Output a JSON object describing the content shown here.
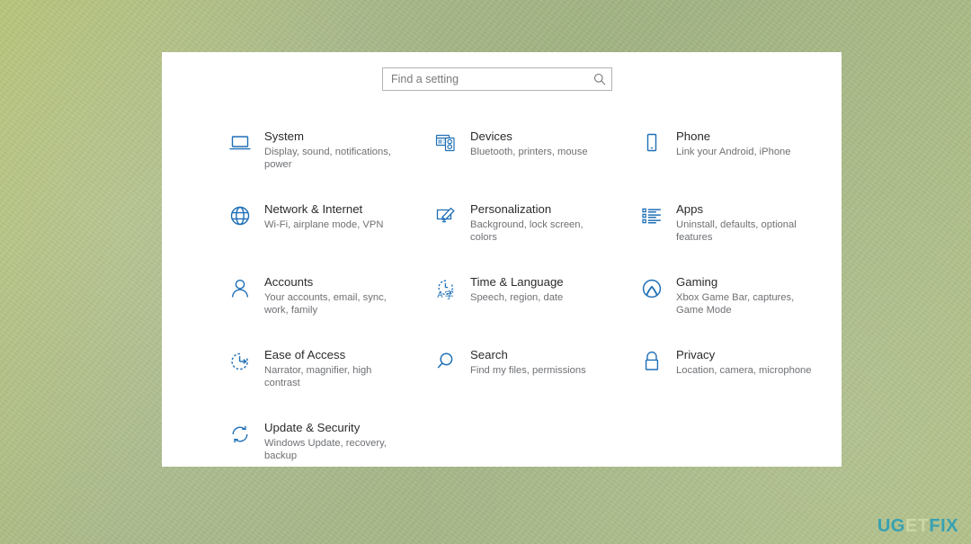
{
  "background": {
    "color": "#a9b98b",
    "accent_color": "#1e6fb6"
  },
  "window": {
    "search": {
      "placeholder": "Find a setting",
      "value": "Find a setting",
      "icon": "search-icon"
    },
    "tiles": [
      {
        "id": "system",
        "icon": "laptop-icon",
        "title": "System",
        "desc": "Display, sound, notifications, power"
      },
      {
        "id": "devices",
        "icon": "keyboard-devices-icon",
        "title": "Devices",
        "desc": "Bluetooth, printers, mouse"
      },
      {
        "id": "phone",
        "icon": "phone-icon",
        "title": "Phone",
        "desc": "Link your Android, iPhone"
      },
      {
        "id": "network-internet",
        "icon": "globe-icon",
        "title": "Network & Internet",
        "desc": "Wi-Fi, airplane mode, VPN"
      },
      {
        "id": "personalization",
        "icon": "paintbrush-monitor-icon",
        "title": "Personalization",
        "desc": "Background, lock screen, colors"
      },
      {
        "id": "apps",
        "icon": "list-icon",
        "title": "Apps",
        "desc": "Uninstall, defaults, optional features"
      },
      {
        "id": "accounts",
        "icon": "person-icon",
        "title": "Accounts",
        "desc": "Your accounts, email, sync, work, family"
      },
      {
        "id": "time-language",
        "icon": "clock-language-icon",
        "title": "Time & Language",
        "desc": "Speech, region, date"
      },
      {
        "id": "gaming",
        "icon": "xbox-icon",
        "title": "Gaming",
        "desc": "Xbox Game Bar, captures, Game Mode"
      },
      {
        "id": "ease-of-access",
        "icon": "ease-of-access-icon",
        "title": "Ease of Access",
        "desc": "Narrator, magnifier, high contrast"
      },
      {
        "id": "search",
        "icon": "magnifier-icon",
        "title": "Search",
        "desc": "Find my files, permissions"
      },
      {
        "id": "privacy",
        "icon": "lock-icon",
        "title": "Privacy",
        "desc": "Location, camera, microphone"
      },
      {
        "id": "update-security",
        "icon": "update-security-icon",
        "title": "Update & Security",
        "desc": "Windows Update, recovery, backup"
      }
    ]
  },
  "annotation": {
    "type": "red-star",
    "color": "#ee1c1c",
    "target": "update-security"
  },
  "watermark": {
    "part1": "UG",
    "part2": "ET",
    "part3": "FIX",
    "color1": "#2f9fb5",
    "color2": "#cfd9a8"
  }
}
